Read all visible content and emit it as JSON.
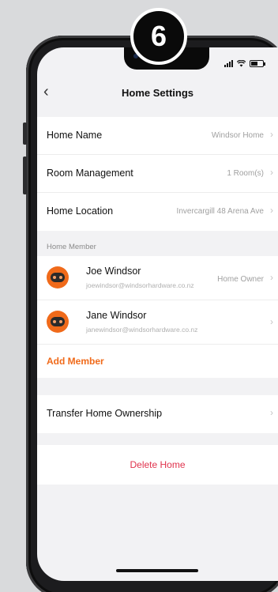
{
  "step_badge": "6",
  "nav": {
    "back_icon": "chevron-left-icon",
    "title": "Home Settings"
  },
  "settings": [
    {
      "label": "Home Name",
      "value": "Windsor Home"
    },
    {
      "label": "Room Management",
      "value": "1 Room(s)"
    },
    {
      "label": "Home Location",
      "value": "Invercargill 48 Arena Ave"
    }
  ],
  "members_section": {
    "label": "Home Member",
    "members": [
      {
        "name": "Joe Windsor",
        "email": "joewindsor@windsorhardware.co.nz",
        "role": "Home Owner"
      },
      {
        "name": "Jane Windsor",
        "email": "janewindsor@windsorhardware.co.nz",
        "role": ""
      }
    ],
    "add_label": "Add Member"
  },
  "transfer_label": "Transfer Home Ownership",
  "delete_label": "Delete Home",
  "colors": {
    "accent": "#f06a1a",
    "danger": "#e0334d",
    "background": "#f2f2f4"
  }
}
